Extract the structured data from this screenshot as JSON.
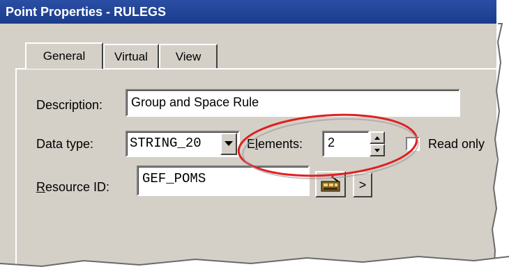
{
  "window": {
    "title": "Point Properties - RULEGS"
  },
  "tabs": [
    {
      "label": "General",
      "active": true
    },
    {
      "label": "Virtual",
      "active": false
    },
    {
      "label": "View",
      "active": false
    }
  ],
  "form": {
    "description_label": "Description:",
    "description_value": "Group and Space Rule",
    "data_type_label": "Data type:",
    "data_type_value": "STRING_20",
    "elements_label_prefix": "E",
    "elements_label_accel": "l",
    "elements_label_rest": "ements:",
    "elements_value": "2",
    "read_only_label": "Read only",
    "read_only_checked": false,
    "resource_label_accel": "R",
    "resource_label_rest": "esource ID:",
    "resource_value": "GEF_POMS",
    "browse_label": ">"
  },
  "annotation": {
    "color": "#e02020"
  },
  "colors": {
    "titlebar": "#1b3c8c",
    "dialog_bg": "#d4d0c8"
  }
}
